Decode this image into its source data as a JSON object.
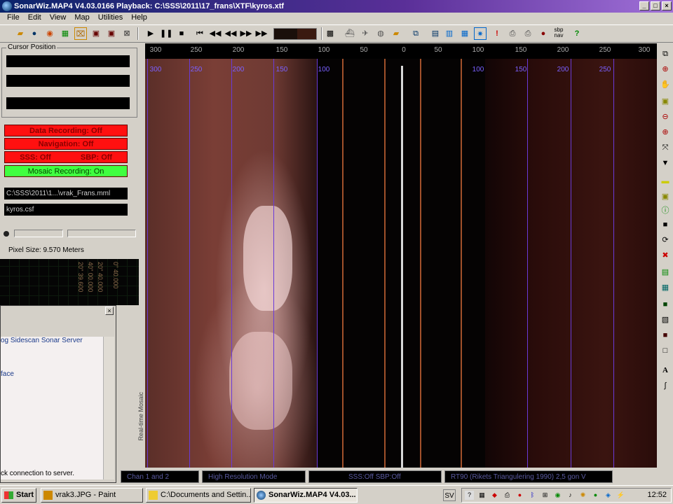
{
  "window": {
    "title": "SonarWiz.MAP4 V4.03.0166 Playback: C:\\SSS\\2011\\17_frans\\XTF\\kyros.xtf"
  },
  "menu": [
    "File",
    "Edit",
    "View",
    "Map",
    "Utilities",
    "Help"
  ],
  "toolbar": {
    "sbp_nav_label": "sbp nav",
    "help_glyph": "?"
  },
  "cursor_panel": {
    "title": "Cursor Position"
  },
  "status": {
    "data_recording": "Data Recording: Off",
    "navigation": "Navigation: Off",
    "sss": "SSS: Off",
    "sbp": "SBP: Off",
    "mosaic": "Mosaic Recording: On"
  },
  "files": {
    "project": "C:\\SSS\\2011\\1...\\vrak_Frans.mml",
    "csf": "kyros.csf"
  },
  "pixel_size": "Pixel Size: 9.570 Meters",
  "dark_strip_labels": [
    "20\" 39.600",
    "40\" 00.000",
    "20\" 40.000",
    "0\" 40.000"
  ],
  "paint_window": {
    "line1": "og Sidescan Sonar Server",
    "line2": "face",
    "line3": "ck connection to server."
  },
  "realtime_label": "Real-time Mosaic",
  "range_scale": {
    "labels": [
      "300",
      "250",
      "200",
      "150",
      "100",
      "50",
      "0",
      "50",
      "100",
      "150",
      "200",
      "250",
      "300"
    ],
    "overlay_labels": [
      "300",
      "250",
      "200",
      "150",
      "100",
      "100",
      "150",
      "200",
      "250"
    ]
  },
  "statusbar": {
    "channels": "Chan 1 and 2",
    "mode": "High Resolution Mode",
    "sss_sbp": "SSS:Off    SBP:Off",
    "projection": "RT90 (Rikets Triangulering 1990) 2,5 gon V"
  },
  "taskbar": {
    "start": "Start",
    "tasks": [
      "vrak3.JPG - Paint",
      "C:\\Documents and Settin...",
      "SonarWiz.MAP4 V4.03..."
    ],
    "lang": "SV",
    "clock": "12:52"
  },
  "colors": {
    "port_tone": "#7a3e36",
    "range_line": "#6a3ad8",
    "nadir": "#d8d8d8",
    "status_red": "#ff1010",
    "status_green": "#40ff40"
  }
}
